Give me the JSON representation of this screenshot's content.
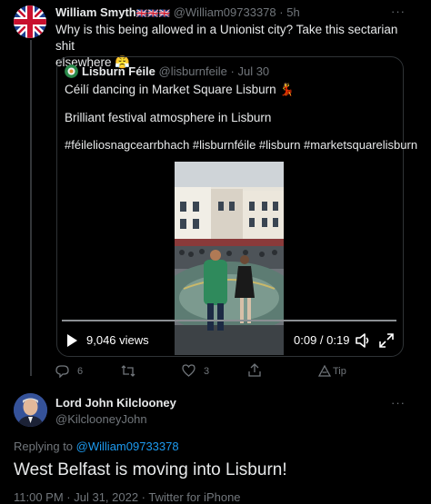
{
  "tweet": {
    "author_name": "William Smyth",
    "author_flags": "🇬🇧🇬🇧🇬🇧",
    "handle": "@William09733378",
    "time": "5h",
    "separator": "·",
    "text_line1": "Why is this being allowed in a Unionist city? Take this sectarian shit",
    "text_line2": "elsewhere",
    "text_emoji": "😤",
    "more": "···"
  },
  "quote": {
    "author_name": "Lisburn Féile",
    "handle": "@lisburnfeile",
    "separator": "·",
    "time": "Jul 30",
    "line1": "Céilí dancing in Market Square Lisburn",
    "line1_emoji": "💃",
    "line2": "Brilliant festival atmosphere in Lisburn",
    "line3": "#féileliosnagcearrbhach #lisburnféile #lisburn #marketsquarelisburn",
    "video": {
      "views": "9,046 views",
      "time": "0:09 / 0:19",
      "progress": 0.0
    }
  },
  "actions": {
    "replies": "6",
    "retweets": "",
    "likes": "3",
    "tip": "Tip"
  },
  "reply": {
    "author_name": "Lord John Kilclooney",
    "handle": "@KilclooneyJohn",
    "replying_prefix": "Replying to",
    "replying_to": "@William09733378",
    "text": "West Belfast is moving into Lisburn!",
    "meta": "11:00 PM · Jul 31, 2022 · Twitter for iPhone",
    "more": "···"
  },
  "colors": {
    "background": "#000000",
    "link": "#1d9bf0",
    "muted": "#71767b",
    "text": "#e7e9ea",
    "border": "#2f3336"
  }
}
